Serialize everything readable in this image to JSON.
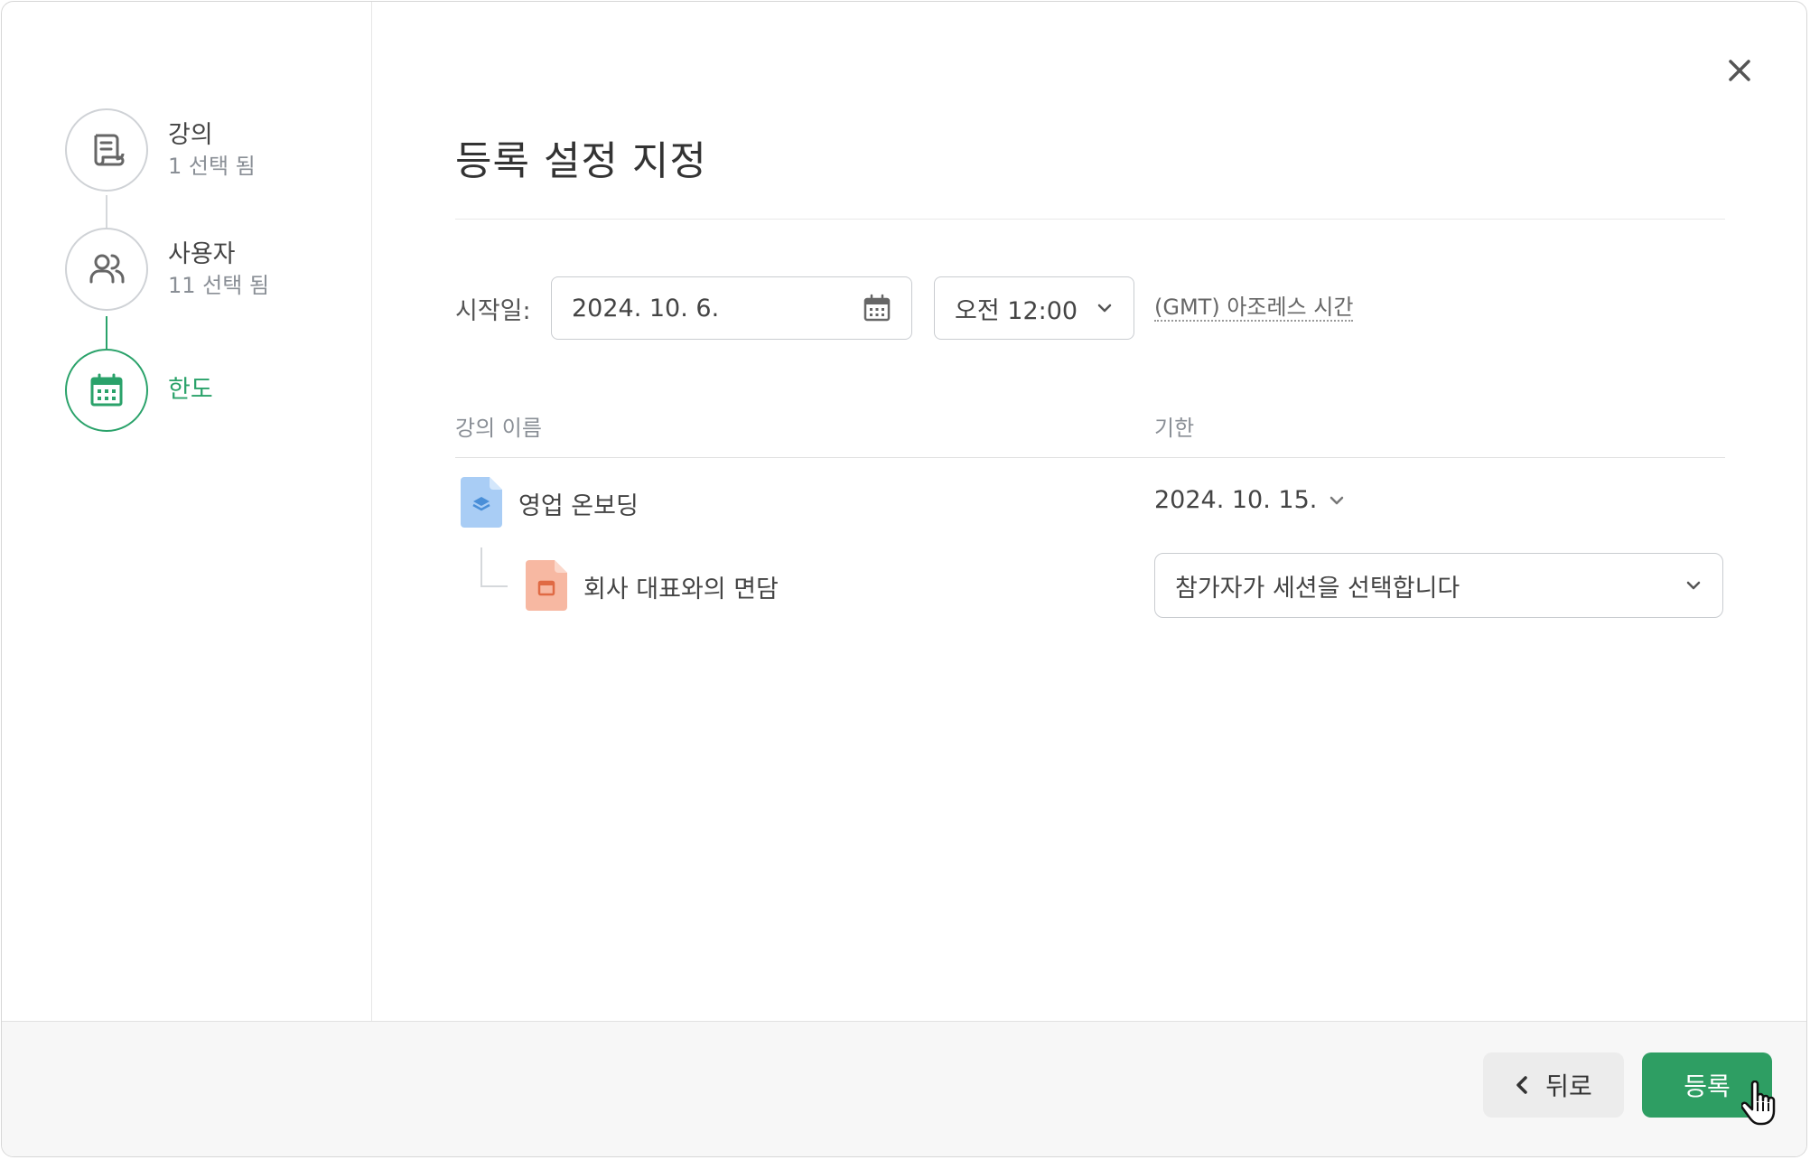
{
  "steps": [
    {
      "title": "강의",
      "subtitle": "1 선택 됨",
      "icon": "document-icon"
    },
    {
      "title": "사용자",
      "subtitle": "11 선택 됨",
      "icon": "users-icon"
    },
    {
      "title": "한도",
      "subtitle": "",
      "icon": "calendar-icon"
    }
  ],
  "main": {
    "title": "등록 설정 지정",
    "start_label": "시작일:",
    "start_date": "2024. 10. 6.",
    "start_time": "오전 12:00",
    "timezone": "(GMT) 아조레스 시간",
    "columns": {
      "course_name": "강의 이름",
      "deadline": "기한"
    },
    "course": {
      "name": "영업 온보딩",
      "deadline": "2024. 10. 15."
    },
    "session": {
      "name": "회사 대표와의 면담",
      "select_value": "참가자가 세션을 선택합니다"
    }
  },
  "footer": {
    "back_label": "뒤로",
    "submit_label": "등록"
  },
  "colors": {
    "accent": "#2e9e63",
    "course_icon": "#a9cdf5",
    "session_icon": "#f7b8a2"
  }
}
